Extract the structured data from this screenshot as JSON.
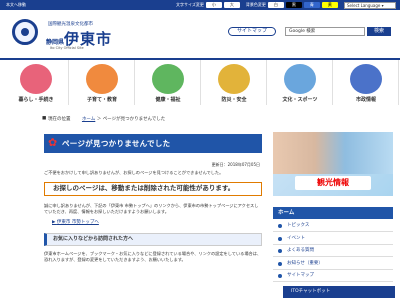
{
  "topbar": {
    "skip": "本文へ移動",
    "fontsize_label": "文字サイズ変更",
    "fontsize_small": "小",
    "fontsize_large": "大",
    "color_label": "背景色変更",
    "colors": [
      "白",
      "黒",
      "青",
      "黄"
    ],
    "language": "Select Language ▾"
  },
  "header": {
    "subtitle": "国際観光温泉文化都市",
    "prefecture": "静岡県",
    "city": "伊東市",
    "english": "Ito City Official Site",
    "sitemap": "サイトマップ",
    "search_placeholder": "Google 検索",
    "search_button": "検索"
  },
  "nav": [
    {
      "label": "暮らし・手続き",
      "color": "#e8637a"
    },
    {
      "label": "子育て・教育",
      "color": "#f08a3e"
    },
    {
      "label": "健康・福祉",
      "color": "#5fb65f"
    },
    {
      "label": "防災・安全",
      "color": "#e2b33a"
    },
    {
      "label": "文化・スポーツ",
      "color": "#6aa6dd"
    },
    {
      "label": "市政情報",
      "color": "#4b72c9"
    }
  ],
  "breadcrumb": {
    "icon": "現在の位置",
    "home": "ホーム",
    "separator": "＞",
    "current": "ページが見つかりませんでした"
  },
  "main": {
    "title": "ページが見つかりませんでした",
    "updated": "更新日：2018年07月05日",
    "p1": "ご不便をおかけして申し訳ありませんが、お探しのページを見つけることができませんでした。",
    "notice": "お探しのページは、移動または削除された可能性があります。",
    "p2": "誠に申し訳ありませんが、下記の「伊東市 市勢トップへ」のリンクから、伊東市の市勢トップページにアクセスしていただき、再度、情報をお探しいただけますようお願いします。",
    "top_link": "伊東市 市勢トップへ",
    "sub_head": "お気に入りなどから訪問された方へ",
    "p3": "伊東市ホームページを、ブックマーク・お気に入りなどに登録されている場合や、リンクの設定をしている場合は、恐れ入りますが、登録の変更をしていただきますよう、お願いいたします。"
  },
  "side": {
    "banner_label": "観光情報",
    "head": "ホーム",
    "items": [
      "トピックス",
      "イベント",
      "よくある質問",
      "お知らせ（重要）",
      "サイトマップ"
    ]
  },
  "chatbot": "ITOチャットボット"
}
